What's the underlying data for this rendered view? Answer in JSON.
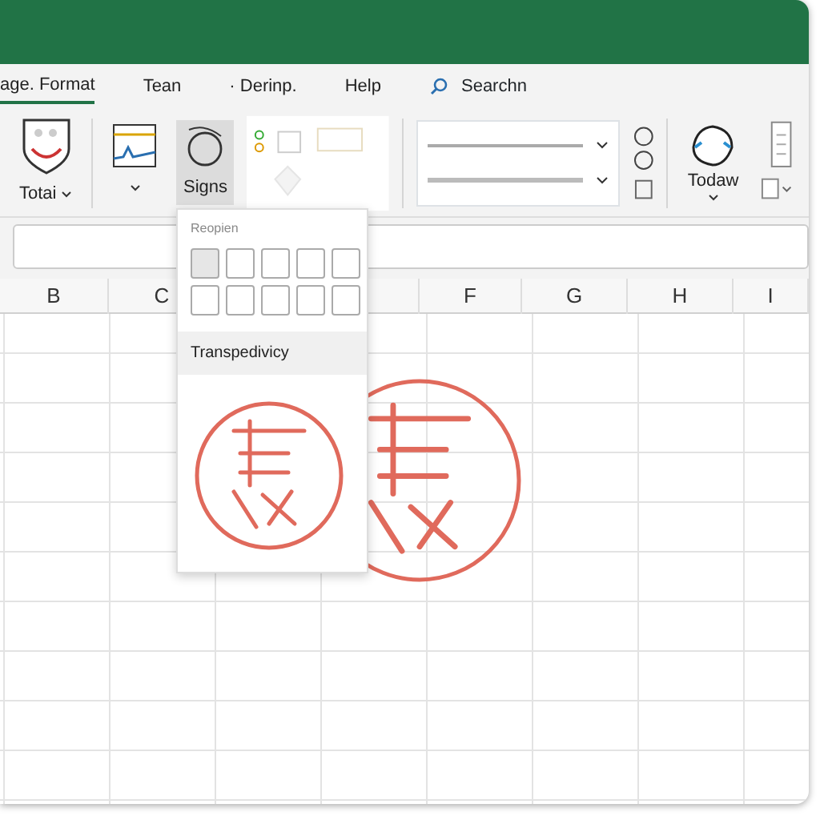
{
  "ribbon_tabs": [
    {
      "label": "age. Format",
      "selected": true
    },
    {
      "label": "Tean",
      "selected": false
    },
    {
      "label": "· Derinp.",
      "selected": false
    },
    {
      "label": "Help",
      "selected": false
    }
  ],
  "search": {
    "label": "Searchn"
  },
  "ribbon_buttons": [
    {
      "kind": "shield",
      "label": "Totai",
      "selected": false
    },
    {
      "kind": "chart",
      "selected": false
    },
    {
      "kind": "shape",
      "label": "Signs",
      "selected": true
    }
  ],
  "right_button": {
    "label": "Todaw"
  },
  "columns": [
    "B",
    "C",
    "F",
    "G",
    "H",
    "I"
  ],
  "popup": {
    "section_label": "Reopien",
    "swatches": [
      {
        "selected": true
      },
      {
        "selected": false
      },
      {
        "selected": false
      },
      {
        "selected": false
      },
      {
        "selected": false
      },
      {
        "selected": false
      },
      {
        "selected": false
      },
      {
        "selected": false
      },
      {
        "selected": false
      },
      {
        "selected": false
      }
    ],
    "item": {
      "label": "Transpedivicy"
    }
  }
}
